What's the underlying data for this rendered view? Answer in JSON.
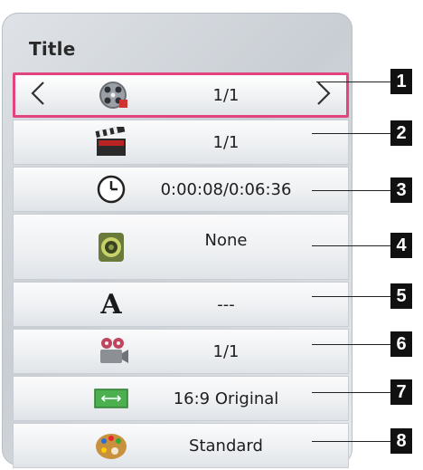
{
  "menu": {
    "title": "Title",
    "rows": [
      {
        "value": "1/1",
        "icon": "film-reel-icon"
      },
      {
        "value": "1/1",
        "icon": "clapperboard-icon"
      },
      {
        "value": "0:00:08/0:06:36",
        "icon": "clock-icon"
      },
      {
        "value": "None",
        "icon": "speaker-icon"
      },
      {
        "value": "---",
        "icon": "subtitle-letter-icon"
      },
      {
        "value": "1/1",
        "icon": "camera-angle-icon"
      },
      {
        "value": "16:9 Original",
        "icon": "aspect-ratio-icon"
      },
      {
        "value": "Standard",
        "icon": "palette-icon"
      }
    ],
    "subtitle_glyph": "A"
  },
  "callouts": [
    "1",
    "2",
    "3",
    "4",
    "5",
    "6",
    "7",
    "8"
  ],
  "colors": {
    "selection": "#e2447e",
    "panel": "#d3d7dc"
  }
}
